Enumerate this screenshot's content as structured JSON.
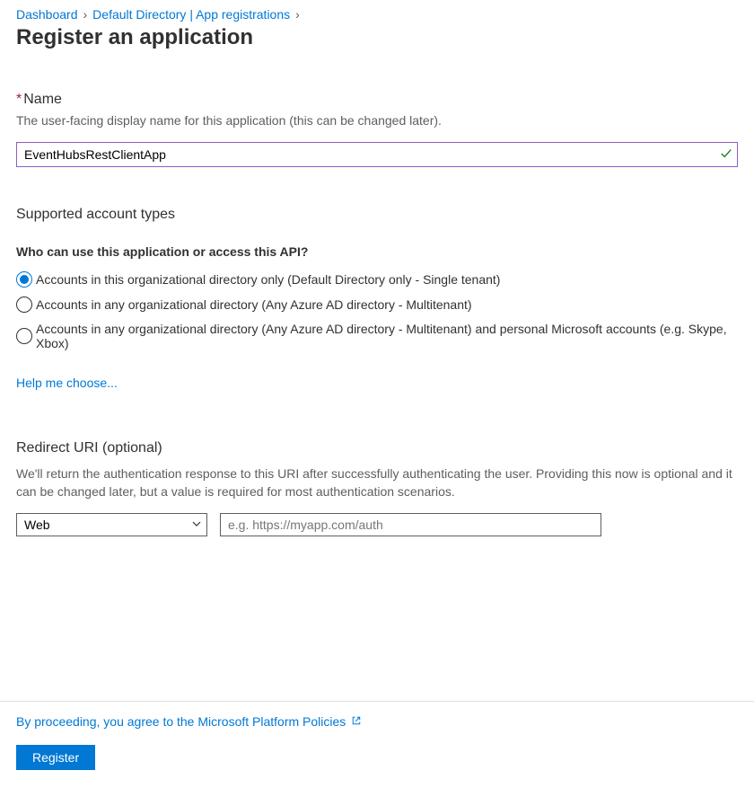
{
  "breadcrumb": {
    "dashboard": "Dashboard",
    "directory": "Default Directory | App registrations"
  },
  "page_title": "Register an application",
  "name_section": {
    "label": "Name",
    "help": "The user-facing display name for this application (this can be changed later).",
    "value": "EventHubsRestClientApp"
  },
  "account_types": {
    "title": "Supported account types",
    "subheading": "Who can use this application or access this API?",
    "options": [
      "Accounts in this organizational directory only (Default Directory only - Single tenant)",
      "Accounts in any organizational directory (Any Azure AD directory - Multitenant)",
      "Accounts in any organizational directory (Any Azure AD directory - Multitenant) and personal Microsoft accounts (e.g. Skype, Xbox)"
    ],
    "help_link": "Help me choose..."
  },
  "redirect": {
    "title": "Redirect URI (optional)",
    "desc": "We'll return the authentication response to this URI after successfully authenticating the user. Providing this now is optional and it can be changed later, but a value is required for most authentication scenarios.",
    "platform_value": "Web",
    "uri_placeholder": "e.g. https://myapp.com/auth"
  },
  "footer": {
    "policy_text": "By proceeding, you agree to the Microsoft Platform Policies",
    "register_label": "Register"
  }
}
